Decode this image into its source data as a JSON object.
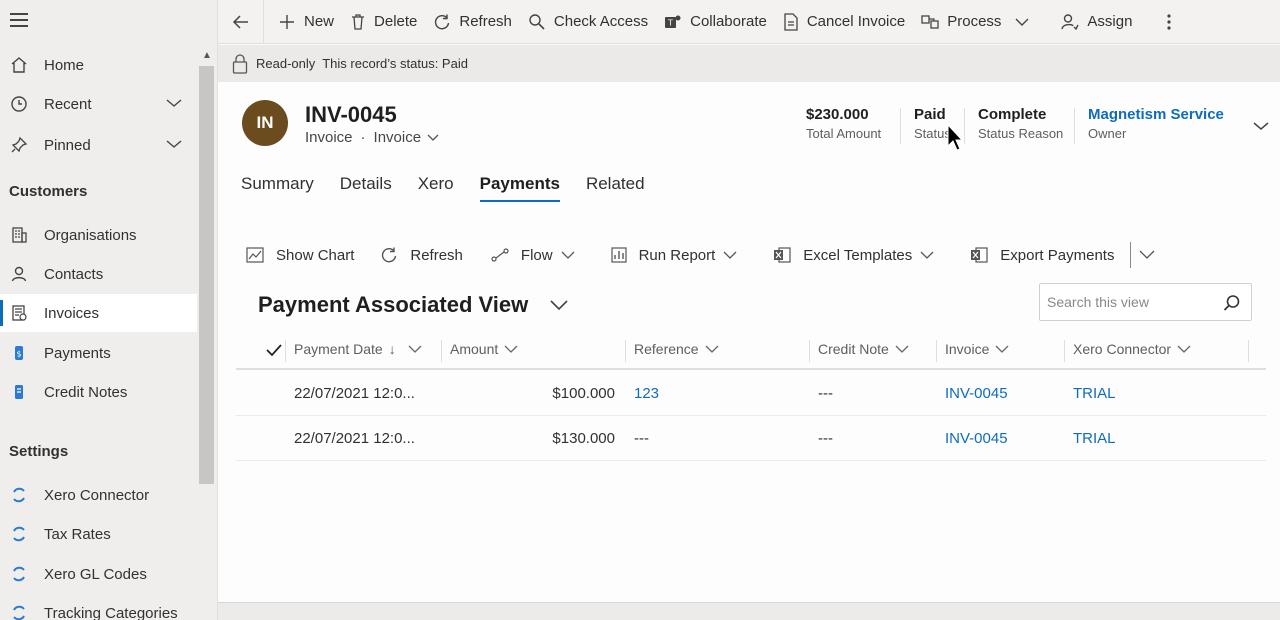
{
  "sidebar": {
    "items": [
      {
        "label": "Home",
        "icon": "home-icon"
      },
      {
        "label": "Recent",
        "icon": "clock-icon"
      },
      {
        "label": "Pinned",
        "icon": "pin-icon"
      }
    ],
    "sections": [
      {
        "heading": "Customers",
        "items": [
          {
            "label": "Organisations",
            "icon": "building-icon"
          },
          {
            "label": "Contacts",
            "icon": "person-icon"
          },
          {
            "label": "Invoices",
            "icon": "invoice-icon",
            "active": true
          },
          {
            "label": "Payments",
            "icon": "payment-icon"
          },
          {
            "label": "Credit Notes",
            "icon": "credit-note-icon"
          }
        ]
      },
      {
        "heading": "Settings",
        "items": [
          {
            "label": "Xero Connector",
            "icon": "sync-icon"
          },
          {
            "label": "Tax Rates",
            "icon": "sync-icon"
          },
          {
            "label": "Xero GL Codes",
            "icon": "sync-icon"
          },
          {
            "label": "Tracking Categories",
            "icon": "sync-icon"
          }
        ]
      }
    ]
  },
  "commandbar": {
    "new": "New",
    "delete": "Delete",
    "refresh": "Refresh",
    "check_access": "Check Access",
    "collaborate": "Collaborate",
    "cancel_invoice": "Cancel Invoice",
    "process": "Process",
    "assign": "Assign"
  },
  "banner": {
    "text": "Read-only  This record’s status: Paid"
  },
  "record": {
    "initials": "IN",
    "title": "INV-0045",
    "entity": "Invoice",
    "form": "Invoice",
    "total_amount": "$230.000",
    "total_amount_label": "Total Amount",
    "status": "Paid",
    "status_label": "Status",
    "status_reason": "Complete",
    "status_reason_label": "Status Reason",
    "owner": "Magnetism Service",
    "owner_label": "Owner"
  },
  "tabs": [
    "Summary",
    "Details",
    "Xero",
    "Payments",
    "Related"
  ],
  "active_tab": "Payments",
  "subgrid": {
    "commands": {
      "show_chart": "Show Chart",
      "refresh": "Refresh",
      "flow": "Flow",
      "run_report": "Run Report",
      "excel_templates": "Excel Templates",
      "export": "Export Payments"
    },
    "view_title": "Payment Associated View",
    "search_placeholder": "Search this view",
    "columns": [
      "Payment Date",
      "Amount",
      "Reference",
      "Credit Note",
      "Invoice",
      "Xero Connector"
    ],
    "rows": [
      {
        "date": "22/07/2021 12:0...",
        "amount": "$100.000",
        "reference": "123",
        "credit_note": "---",
        "invoice": "INV-0045",
        "connector": "TRIAL"
      },
      {
        "date": "22/07/2021 12:0...",
        "amount": "$130.000",
        "reference": "---",
        "credit_note": "---",
        "invoice": "INV-0045",
        "connector": "TRIAL"
      }
    ]
  },
  "colors": {
    "accent": "#0f6cbd",
    "avatar": "#6b4c1e"
  }
}
